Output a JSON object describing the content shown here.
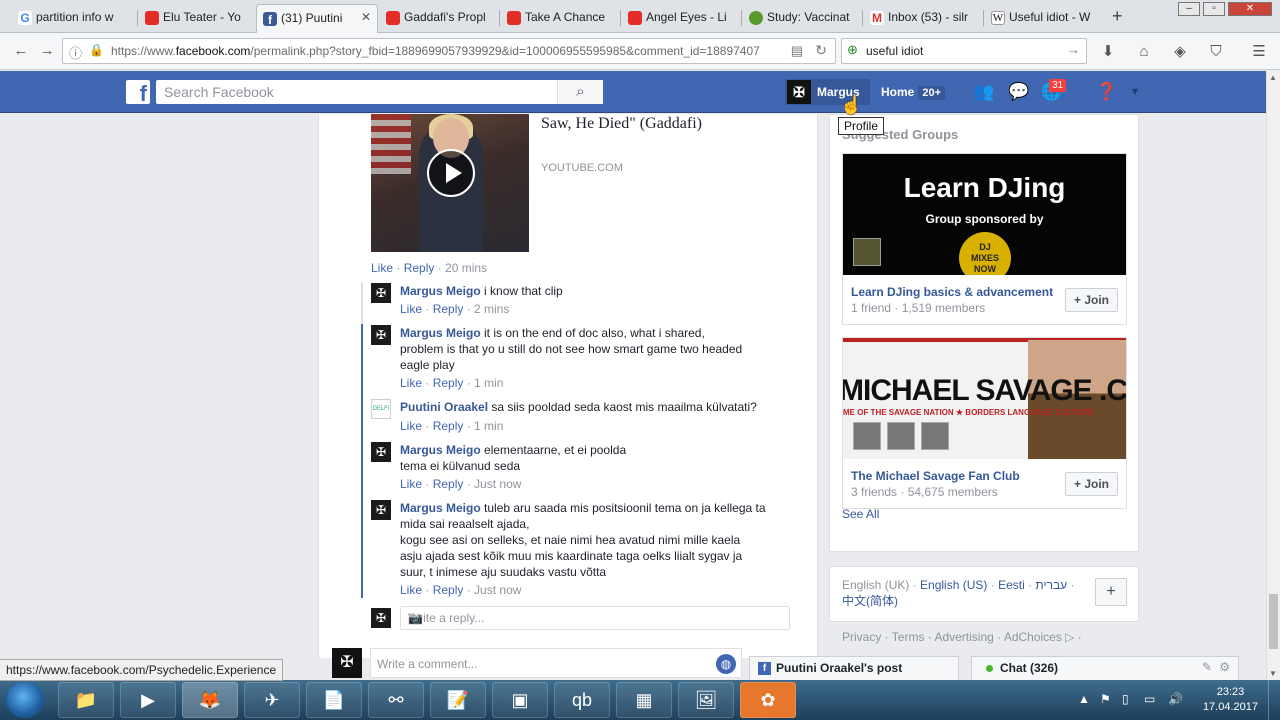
{
  "browser": {
    "tabs": [
      {
        "label": "partition info w",
        "icon": "google-icon"
      },
      {
        "label": "Elu Teater - Yo",
        "icon": "youtube-icon"
      },
      {
        "label": "(31) Puutini",
        "icon": "facebook-icon",
        "active": true
      },
      {
        "label": "Gaddafi's Propl",
        "icon": "youtube-icon"
      },
      {
        "label": "Take A Chance",
        "icon": "youtube-icon"
      },
      {
        "label": "Angel Eyes - Li",
        "icon": "youtube-icon"
      },
      {
        "label": "Study: Vaccinat",
        "icon": "leaf-icon"
      },
      {
        "label": "Inbox (53) - silr",
        "icon": "gmail-icon"
      },
      {
        "label": "Useful idiot - W",
        "icon": "wikipedia-icon"
      }
    ],
    "new_tab": "+",
    "url_prefix": "https://www.",
    "url_domain": "facebook.com",
    "url_rest": "/permalink.php?story_fbid=1889699057939929&id=100006955595985&comment_id=18897407",
    "search_value": "useful idiot",
    "status_url": "https://www.facebook.com/Psychedelic.Experience"
  },
  "fb": {
    "search_placeholder": "Search Facebook",
    "profile_name": "Margus",
    "home_label": "Home",
    "home_count": "20+",
    "notif_count": "31",
    "tooltip": "Profile"
  },
  "post": {
    "video_title": "Saw, He Died\" (Gaddafi)",
    "video_source": "YOUTUBE.COM",
    "actions": {
      "like": "Like",
      "reply": "Reply",
      "time": "20 mins"
    },
    "comments": [
      {
        "author": "Margus Meigo",
        "text": "i know that clip",
        "time": "2 mins"
      },
      {
        "author": "Margus Meigo",
        "text": "it is on the end of doc also, what i shared,\nproblem is that yo u still do not see how smart game two headed\neagle play",
        "time": "1 min"
      },
      {
        "author": "Puutini Oraakel",
        "text": "sa siis pooldad seda kaost mis maailma külvatati?",
        "time": "1 min"
      },
      {
        "author": "Margus Meigo",
        "text": "elementaarne, et ei poolda\ntema ei külvanud seda",
        "time": "Just now"
      },
      {
        "author": "Margus Meigo",
        "text": "tuleb aru saada mis positsioonil tema on ja kellega ta\nmida sai reaalselt ajada,\nkogu see asi on selleks, et naie nimi hea avatud nimi mille kaela\nasju ajada sest kõik muu mis kaardinate taga oelks liialt sygav ja\nsuur, t inimese aju suudaks vastu võtta",
        "time": "Just now"
      }
    ],
    "like_label": "Like",
    "reply_label": "Reply",
    "reply_placeholder": "Write a reply...",
    "comment_placeholder": "Write a comment..."
  },
  "right": {
    "section_title": "Suggested Groups",
    "groups": [
      {
        "name": "Learn DJing basics & advancement",
        "meta": "1 friend · 1,519 members",
        "join": "+ Join",
        "cover_title": "Learn DJing",
        "cover_sub": "Group sponsored by"
      },
      {
        "name": "The Michael Savage Fan Club",
        "meta": "3 friends · 54,675 members",
        "join": "+ Join",
        "cover_title": "MICHAEL SAVAGE .COM"
      }
    ],
    "see_all": "See All",
    "languages": {
      "current": "English (UK)",
      "others": [
        "English (US)",
        "Eesti",
        "עברית",
        "中文(简体)"
      ]
    },
    "footer_links": "Privacy · Terms · Advertising · AdChoices ▷ ·"
  },
  "dock": {
    "post_tab": "Puutini Oraakel's post",
    "chat": "Chat (326)"
  },
  "taskbar": {
    "time": "23:23",
    "date": "17.04.2017"
  },
  "colors": {
    "fb_blue": "#4267b2",
    "link": "#365899",
    "meta": "#90949c"
  }
}
